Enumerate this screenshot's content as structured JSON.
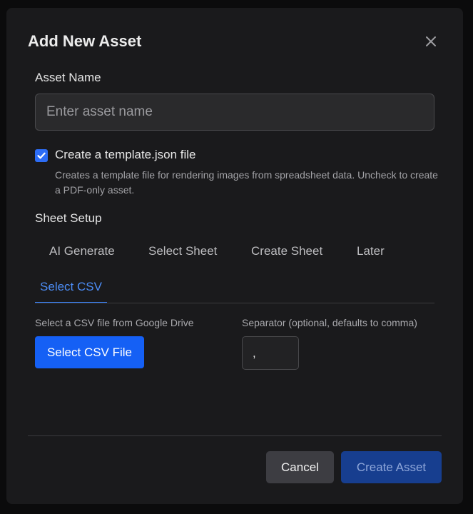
{
  "dialog": {
    "title": "Add New Asset",
    "close_icon": "close-icon"
  },
  "asset_name": {
    "label": "Asset Name",
    "value": "",
    "placeholder": "Enter asset name"
  },
  "template_option": {
    "checked": true,
    "label": "Create a template.json file",
    "description": "Creates a template file for rendering images from spreadsheet data. Uncheck to create a PDF-only asset."
  },
  "sheet_setup": {
    "label": "Sheet Setup",
    "tabs": [
      {
        "label": "AI Generate",
        "active": false
      },
      {
        "label": "Select Sheet",
        "active": false
      },
      {
        "label": "Create Sheet",
        "active": false
      },
      {
        "label": "Later",
        "active": false
      },
      {
        "label": "Select CSV",
        "active": true
      }
    ],
    "csv_hint": "Select a CSV file from Google Drive",
    "csv_button_label": "Select CSV File",
    "separator_hint": "Separator (optional, defaults to comma)",
    "separator_value": ","
  },
  "footer": {
    "cancel_label": "Cancel",
    "create_label": "Create Asset"
  },
  "colors": {
    "accent": "#1560f5",
    "active_tab": "#4c8df6",
    "dialog_background": "#1a1a1c",
    "page_background": "#0b0b0c",
    "disabled_primary": "#173e8f"
  }
}
